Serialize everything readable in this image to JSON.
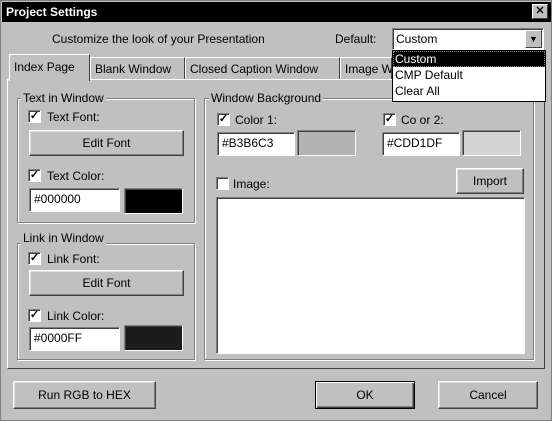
{
  "window": {
    "title": "Project Settings"
  },
  "header": {
    "text": "Customize the look of your Presentation",
    "default_label": "Default:"
  },
  "default_combo": {
    "value": "Custom",
    "options": [
      "Custom",
      "CMP Default",
      "Clear All"
    ]
  },
  "tabs": [
    "Index Page",
    "Blank Window",
    "Closed Caption Window",
    "Image W"
  ],
  "text_group": {
    "label": "Text in Window",
    "font_checkbox": "Text Font:",
    "edit_font_button": "Edit Font",
    "color_checkbox": "Text Color:",
    "color_value": "#000000",
    "swatch_color": "#000000"
  },
  "link_group": {
    "label": "Link in Window",
    "font_checkbox": "Link Font:",
    "edit_font_button": "Edit Font",
    "color_checkbox": "Link Color:",
    "color_value": "#0000FF",
    "swatch_color": "#1c1c1c"
  },
  "background_group": {
    "label": "Window Background",
    "color1_label": "Color 1:",
    "color1_value": "#B3B6C3",
    "color1_swatch": "#b3b3b3",
    "color2_label": "Co or 2:",
    "color2_value": "#CDD1DF",
    "color2_swatch": "#d3d3d3",
    "image_label": "Image:",
    "import_button": "Import"
  },
  "footer": {
    "rgb_button": "Run RGB to HEX",
    "ok_button": "OK",
    "cancel_button": "Cancel"
  },
  "checked_mark": "✓"
}
